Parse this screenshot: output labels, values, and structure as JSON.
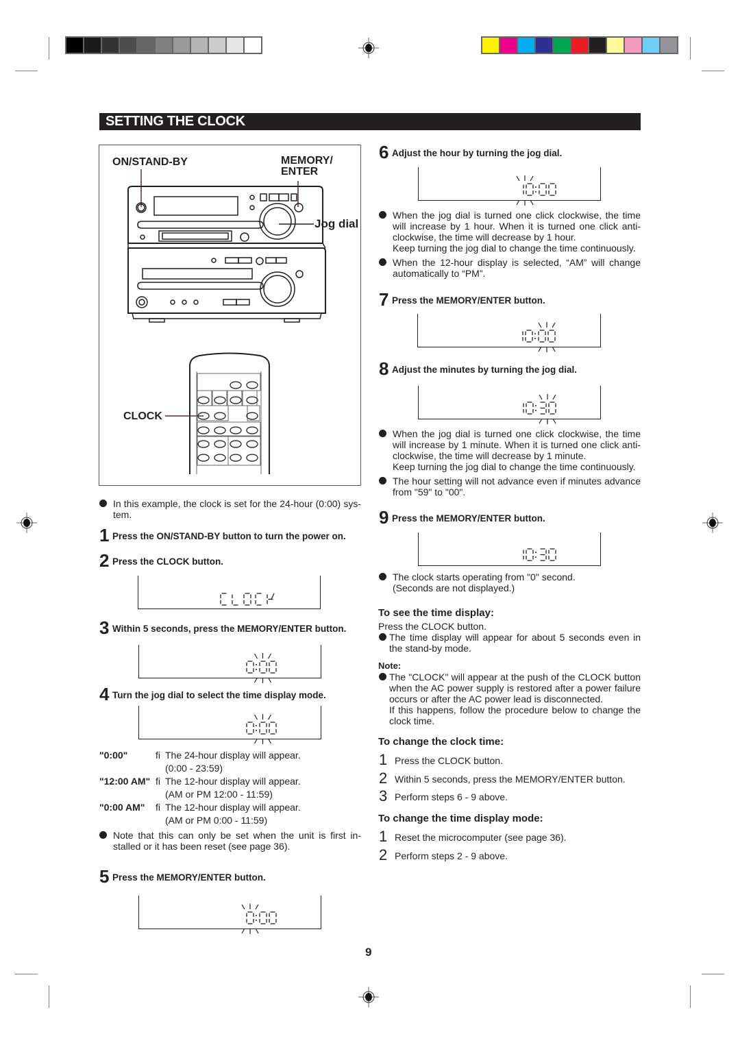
{
  "print_marks": {
    "gray_swatches": [
      "#000000",
      "#1a1a1a",
      "#333333",
      "#4d4d4d",
      "#666666",
      "#808080",
      "#999999",
      "#b3b3b3",
      "#cccccc",
      "#e6e6e6",
      "#ffffff"
    ],
    "color_swatches": [
      "#fff200",
      "#ec008c",
      "#00aeef",
      "#2e3192",
      "#00a651",
      "#ed1c24",
      "#231f20",
      "#fff799",
      "#f49ac1",
      "#6dcff6",
      "#939598"
    ]
  },
  "title": "SETTING THE CLOCK",
  "figure": {
    "label_power": "ON/STAND-BY",
    "label_memory_line1": "MEMORY/",
    "label_memory_line2": "ENTER",
    "label_jog": "Jog dial",
    "label_clock": "CLOCK"
  },
  "left": {
    "intro_bullet": "In this example, the clock is set for the 24-hour (0:00) sys- tem.",
    "steps": [
      {
        "num": "1",
        "label": "Press the ON/STAND-BY button to turn the power on."
      },
      {
        "num": "2",
        "label": "Press the CLOCK button.",
        "display": "CLOCK"
      },
      {
        "num": "3",
        "label": "Within 5 seconds, press the MEMORY/ENTER button.",
        "display": "0:00"
      },
      {
        "num": "4",
        "label": "Turn the jog dial to select the time display mode.",
        "display": "0:00"
      },
      {
        "num": "5",
        "label": "Press the MEMORY/ENTER button.",
        "display": "0:00"
      }
    ],
    "modes": [
      {
        "key": "\"0:00\"",
        "arrow": "fi",
        "line1": "The 24-hour display will appear.",
        "line2": "(0:00 - 23:59)"
      },
      {
        "key": "\"12:00 AM\"",
        "arrow": "fi",
        "line1": "The 12-hour display will appear.",
        "line2": "(AM or PM 12:00 - 11:59)"
      },
      {
        "key": "\"0:00 AM\"",
        "arrow": "fi",
        "line1": "The 12-hour display will appear.",
        "line2": "(AM or PM 0:00 - 11:59)"
      }
    ],
    "note_bullet": "Note that this can only be set when the unit is first in- stalled or it has been reset (see page 36)."
  },
  "right": {
    "steps": [
      {
        "num": "6",
        "label": "Adjust the hour by turning the jog dial.",
        "display": "10:00"
      },
      {
        "num": "7",
        "label": "Press the MEMORY/ENTER button.",
        "display": "10:00"
      },
      {
        "num": "8",
        "label": "Adjust the minutes by turning the jog dial.",
        "display": "10:30"
      },
      {
        "num": "9",
        "label": "Press the MEMORY/ENTER button.",
        "display": "10:30"
      }
    ],
    "step6_bullets": [
      "When the jog dial is turned one click clockwise, the time will increase by 1 hour. When it is turned one click anti- clockwise, the time will decrease by 1 hour.",
      "Keep turning the jog dial to change the time continuously.",
      "When the 12-hour display is selected, “AM” will change automatically to “PM”."
    ],
    "step8_bullets": [
      "When the jog dial is turned one click clockwise, the time will increase by 1 minute. When it is turned one click anti- clockwise, the time will decrease by 1 minute.",
      "Keep turning the jog dial to change the time continuously.",
      "The hour setting will not advance even if minutes advance from \"59\" to \"00\"."
    ],
    "step9_bullet": "The clock starts operating from \"0\" second. (Seconds are not displayed.)",
    "see_time": {
      "heading": "To see the time display:",
      "line": "Press the CLOCK button.",
      "bullet": "The time display will appear for about 5 seconds even in the stand-by mode."
    },
    "note": {
      "heading": "Note:",
      "bullet": "The \"CLOCK\" will appear at the push of the CLOCK button when the AC power supply is restored after a power failure occurs or after the AC power lead is disconnected.",
      "extra": "If this happens, follow the procedure below to change the clock time."
    },
    "change_clock": {
      "heading": "To change the clock time:",
      "items": [
        {
          "n": "1",
          "t": "Press the CLOCK button."
        },
        {
          "n": "2",
          "t": "Within 5 seconds, press the MEMORY/ENTER button."
        },
        {
          "n": "3",
          "t": "Perform steps 6 - 9 above."
        }
      ]
    },
    "change_mode": {
      "heading": "To change the time display mode:",
      "items": [
        {
          "n": "1",
          "t": "Reset the microcomputer (see page 36)."
        },
        {
          "n": "2",
          "t": "Perform steps 2 - 9 above."
        }
      ]
    }
  },
  "page_number": "9"
}
